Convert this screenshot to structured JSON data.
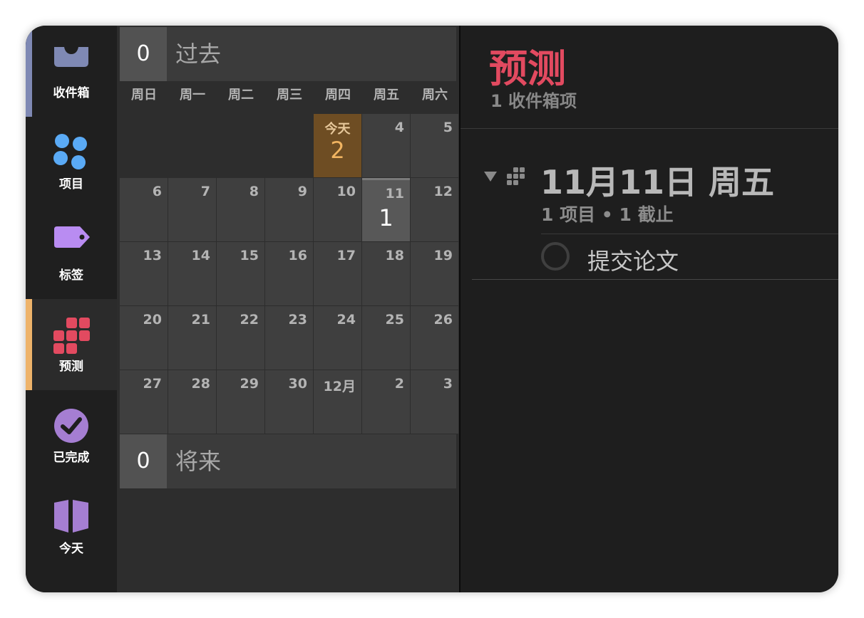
{
  "sidebar": {
    "items": [
      {
        "label": "收件箱",
        "icon": "inbox-tray-icon",
        "accent": "#7f89b4"
      },
      {
        "label": "项目",
        "icon": "projects-dots-icon",
        "accent": "#5aaaf5"
      },
      {
        "label": "标签",
        "icon": "tag-icon",
        "accent": "#b98cf2"
      },
      {
        "label": "预测",
        "icon": "forecast-grid-icon",
        "accent": "#e24a60",
        "active": true
      },
      {
        "label": "已完成",
        "icon": "completed-check-icon",
        "accent": "#a57ed2"
      },
      {
        "label": "今天",
        "icon": "today-book-icon",
        "accent": "#a57ed2"
      }
    ]
  },
  "calendar": {
    "past": {
      "count": "0",
      "label": "过去"
    },
    "future": {
      "count": "0",
      "label": "将来"
    },
    "weekdays": [
      "周日",
      "周一",
      "周二",
      "周三",
      "周四",
      "周五",
      "周六"
    ],
    "today_label": "今天",
    "weeks": [
      [
        {
          "d": ""
        },
        {
          "d": ""
        },
        {
          "d": ""
        },
        {
          "d": ""
        },
        {
          "d": "",
          "today": true,
          "count": "2"
        },
        {
          "d": "4"
        },
        {
          "d": "5"
        }
      ],
      [
        {
          "d": "6"
        },
        {
          "d": "7"
        },
        {
          "d": "8"
        },
        {
          "d": "9"
        },
        {
          "d": "10"
        },
        {
          "d": "11",
          "selected": true,
          "count": "1"
        },
        {
          "d": "12"
        }
      ],
      [
        {
          "d": "13"
        },
        {
          "d": "14"
        },
        {
          "d": "15"
        },
        {
          "d": "16"
        },
        {
          "d": "17"
        },
        {
          "d": "18"
        },
        {
          "d": "19"
        }
      ],
      [
        {
          "d": "20"
        },
        {
          "d": "21"
        },
        {
          "d": "22"
        },
        {
          "d": "23"
        },
        {
          "d": "24"
        },
        {
          "d": "25"
        },
        {
          "d": "26"
        }
      ],
      [
        {
          "d": "27"
        },
        {
          "d": "28"
        },
        {
          "d": "29"
        },
        {
          "d": "30"
        },
        {
          "d": "12月"
        },
        {
          "d": "2"
        },
        {
          "d": "3"
        }
      ]
    ]
  },
  "main": {
    "title": "预测",
    "subtitle": "1 收件箱项",
    "group": {
      "date": "11月11日 周五",
      "meta": "1 项目 • 1 截止",
      "task": "提交论文"
    }
  },
  "colors": {
    "forecast_accent": "#e24a60",
    "today_bg": "#6e4d23",
    "today_count": "#f1b461"
  }
}
